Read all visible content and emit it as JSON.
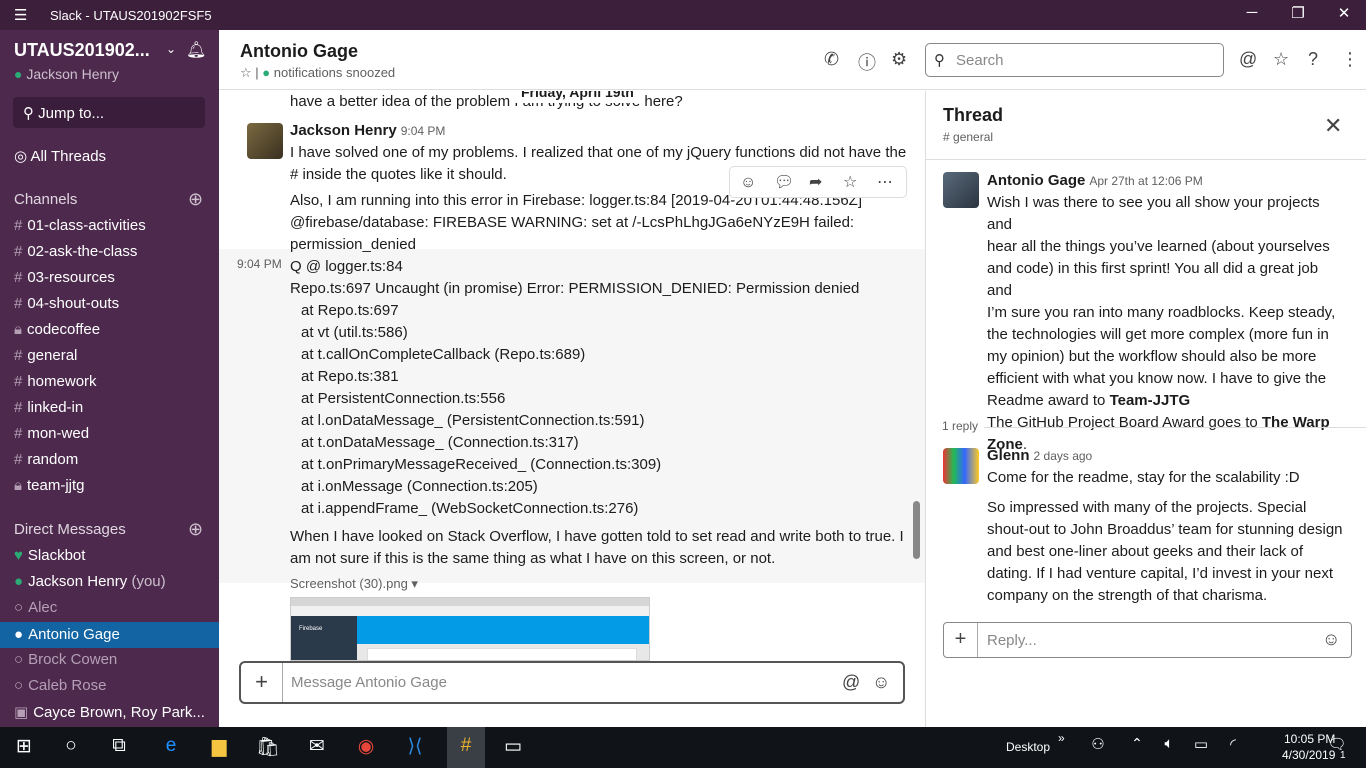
{
  "window": {
    "title": "Slack - UTAUS201902FSF5"
  },
  "sidebar": {
    "workspace": "UTAUS201902...",
    "user": "Jackson Henry",
    "jump": "Jump to...",
    "all_threads": "All Threads",
    "channels_header": "Channels",
    "channels": [
      "01-class-activities",
      "02-ask-the-class",
      "03-resources",
      "04-shout-outs",
      "codecoffee",
      "general",
      "homework",
      "linked-in",
      "mon-wed",
      "random",
      "team-jjtg"
    ],
    "dm_header": "Direct Messages",
    "dms": [
      "Slackbot",
      "Jackson Henry",
      "Alec",
      "Antonio Gage",
      "Brock Cowen",
      "Caleb Rose",
      "Cayce Brown, Roy Park..."
    ],
    "dm_you": "(you)"
  },
  "header": {
    "name": "Antonio Gage",
    "status": "notifications snoozed",
    "search_placeholder": "Search"
  },
  "feed": {
    "date": "Friday, April 19th",
    "m0": "have a better idea of the problem I am trying to solve here?",
    "m1_author": "Jackson Henry",
    "m1_time": "9:04 PM",
    "m1_l1": "I have solved one of my problems. I realized that one of my jQuery functions did not have the",
    "m1_l2": "# inside the quotes like it should.",
    "m2_time": "9:04 PM",
    "m2_lines": [
      "Also, I am running into this error in Firebase: logger.ts:84 [2019-04-20T01:44:48.156Z]",
      "@firebase/database: FIREBASE WARNING: set at /-LcsPhLhgJGa6eNYzE9H failed:",
      "permission_denied",
      "Q @ logger.ts:84",
      "Repo.ts:697 Uncaught (in promise) Error: PERMISSION_DENIED: Permission denied"
    ],
    "m2_stack": [
      "at Repo.ts:697",
      "at vt (util.ts:586)",
      "at t.callOnCompleteCallback (Repo.ts:689)",
      "at Repo.ts:381",
      "at PersistentConnection.ts:556",
      "at l.onDataMessage_ (PersistentConnection.ts:591)",
      "at t.onDataMessage_ (Connection.ts:317)",
      "at t.onPrimaryMessageReceived_ (Connection.ts:309)",
      "at i.onMessage (Connection.ts:205)",
      "at i.appendFrame_ (WebSocketConnection.ts:276)"
    ],
    "m3_l1": "When I have looked on Stack Overflow, I have gotten told to set read and write both to true. I",
    "m3_l2": "am not sure if this is the same thing as what I have on this screen, or not.",
    "file_name": "Screenshot (30).png",
    "thumb_label": "Firebase"
  },
  "composer": {
    "placeholder": "Message Antonio Gage"
  },
  "thread": {
    "title": "Thread",
    "channel": "general",
    "p_author": "Antonio Gage",
    "p_time": "Apr 27th at 12:06 PM",
    "p_lines": [
      "Wish I was there to see you all show your projects and",
      "hear all the things you’ve learned (about yourselves",
      "and code) in this first sprint! You all did a great job and",
      "I’m sure you ran into many roadblocks. Keep steady,",
      "the technologies will get more complex (more fun in",
      "my opinion) but the workflow should also be more",
      "efficient with what you know now. I have to give the"
    ],
    "p_award1_pre": "Readme award to ",
    "p_award1_bold": "Team-JJTG",
    "p_award2_pre": "The GitHub Project Board Award goes to ",
    "p_award2_bold": "The Warp",
    "p_award2_tail": "Zone",
    "p_award2_end": ".",
    "reply_count": "1 reply",
    "r_author": "Glenn",
    "r_time": "2 days ago",
    "r_l1": "Come for the readme, stay for the scalability :D",
    "r_lines": [
      "So impressed with many of the projects.  Special",
      "shout-out to John Broaddus’ team for stunning design",
      "and best one-liner about geeks and their lack of",
      "dating.  If I had venture capital, I’d invest in your next",
      "company on the strength of that charisma."
    ],
    "reply_placeholder": "Reply..."
  },
  "taskbar": {
    "desktop": "Desktop",
    "time": "10:05 PM",
    "date": "4/30/2019",
    "notif": "1"
  }
}
